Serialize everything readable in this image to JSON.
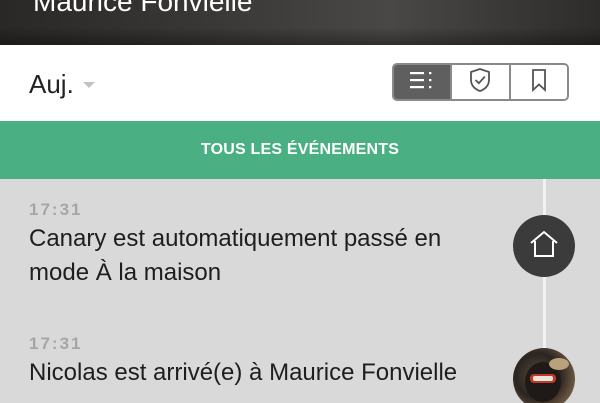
{
  "header": {
    "location_title": "Maurice Fonvielle"
  },
  "toolbar": {
    "date_filter": {
      "selected": "Auj."
    },
    "view_toggle": {
      "active": "list",
      "buttons": [
        "list-icon",
        "shield-icon",
        "bookmark-icon"
      ]
    }
  },
  "banner": {
    "label": "TOUS LES ÉVÉNEMENTS"
  },
  "colors": {
    "banner": "#4aaf82",
    "active_toggle": "#5f5f5f",
    "timeline_bg": "#d9d9d9"
  },
  "events": [
    {
      "time": "17:31",
      "text": "Canary est automatiquement passé en mode À la maison",
      "icon": "home-icon"
    },
    {
      "time": "17:31",
      "text": "Nicolas est arrivé(e) à Maurice Fonvielle",
      "icon": "avatar"
    }
  ]
}
